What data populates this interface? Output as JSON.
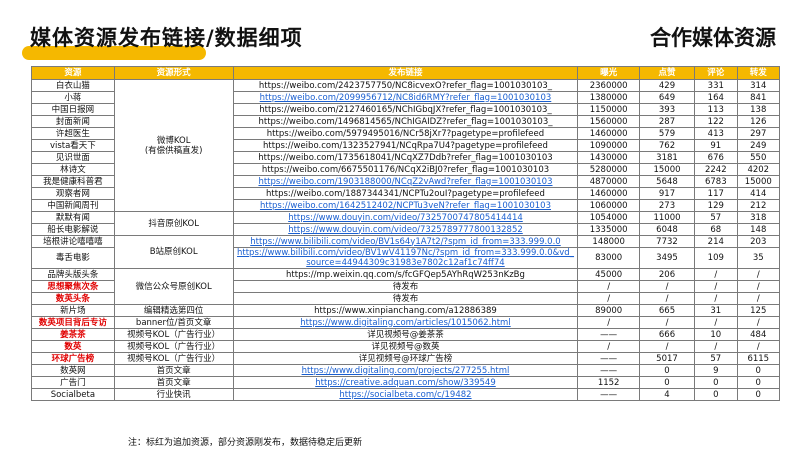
{
  "title_left": "媒体资源发布链接/数据细项",
  "title_right": "合作媒体资源",
  "accent_color": "#f5b800",
  "link_color": "#1a5fd0",
  "highlight_color": "#e00000",
  "headers": [
    "资源",
    "资源形式",
    "发布链接",
    "曝光",
    "点赞",
    "评论",
    "转发"
  ],
  "forms": {
    "weibo": "微博KOL\n(有偿供稿直发)",
    "douyin": "抖音原创KOL",
    "bilibili": "B站原创KOL",
    "wechat": "微信公众号原创KOL",
    "editor": "编辑精选第四位",
    "banner": "banner位/首页文章",
    "video1": "视频号KOL（广告行业）",
    "video2": "视频号KOL（广告行业）",
    "video3": "视频号KOL（广告行业）",
    "home1": "首页文章",
    "home2": "首页文章",
    "flash": "行业快讯"
  },
  "rows": [
    {
      "name": "白衣山猫",
      "link": "https://weibo.com/2423757750/NC8icvexO?refer_flag=1001030103_",
      "exposure": "2360000",
      "likes": "429",
      "comments": "331",
      "shares": "314"
    },
    {
      "name": "小蒋",
      "link": "https://weibo.com/2099956712/NC8id6RMY?refer_flag=1001030103",
      "exposure": "1380000",
      "likes": "649",
      "comments": "164",
      "shares": "841"
    },
    {
      "name": "中国日报网",
      "link": "https://weibo.com/2127460165/NChIGbqJX?refer_flag=1001030103_",
      "exposure": "1150000",
      "likes": "393",
      "comments": "113",
      "shares": "138"
    },
    {
      "name": "封面新闻",
      "link": "https://weibo.com/1496814565/NChIGAIDZ?refer_flag=1001030103_",
      "exposure": "1560000",
      "likes": "287",
      "comments": "122",
      "shares": "126"
    },
    {
      "name": "许超医生",
      "link": "https://weibo.com/5979495016/NCr58jXr7?pagetype=profilefeed",
      "exposure": "1460000",
      "likes": "579",
      "comments": "413",
      "shares": "297"
    },
    {
      "name": "vista看天下",
      "link": "https://weibo.com/1323527941/NCqRpa7U4?pagetype=profilefeed",
      "exposure": "1090000",
      "likes": "762",
      "comments": "91",
      "shares": "249"
    },
    {
      "name": "见识世面",
      "link": "https://weibo.com/1735618041/NCqXZ7Ddb?refer_flag=1001030103",
      "exposure": "1430000",
      "likes": "3181",
      "comments": "676",
      "shares": "550"
    },
    {
      "name": "林诗文",
      "link": "https://weibo.com/6675501176/NCqX2iBJ0?refer_flag=1001030103",
      "exposure": "5280000",
      "likes": "15000",
      "comments": "2242",
      "shares": "4202"
    },
    {
      "name": "我是健康科普君",
      "link": "https://weibo.com/1903188000/NCqZ2vAwd?refer_flag=1001030103",
      "exposure": "4870000",
      "likes": "5648",
      "comments": "6783",
      "shares": "15000"
    },
    {
      "name": "观察者网",
      "link": "https://weibo.com/1887344341/NCPTu2ouI?pagetype=profilefeed",
      "exposure": "1460000",
      "likes": "917",
      "comments": "117",
      "shares": "414"
    },
    {
      "name": "中国新闻周刊",
      "link": "https://weibo.com/1642512402/NCPTu3veN?refer_flag=1001030103",
      "exposure": "1060000",
      "likes": "273",
      "comments": "129",
      "shares": "212"
    },
    {
      "name": "默默有闻",
      "link": "https://www.douyin.com/video/7325700747805414414",
      "exposure": "1054000",
      "likes": "11000",
      "comments": "57",
      "shares": "318"
    },
    {
      "name": "船长电影解说",
      "link": "https://www.douyin.com/video/7325789777800132852",
      "exposure": "1335000",
      "likes": "6048",
      "comments": "68",
      "shares": "148"
    },
    {
      "name": "培根讲论嘻嘻嘻",
      "link": "https://www.bilibili.com/video/BV1s64y1A7t2/?spm_id_from=333.999.0.0",
      "exposure": "148000",
      "likes": "7732",
      "comments": "214",
      "shares": "203"
    },
    {
      "name": "毒舌电影",
      "link": "https://www.bilibili.com/video/BV1wV41197Nc/?spm_id_from=333.999.0.0&vd_source=44944309c31983e7802c12af1c74ff74",
      "exposure": "83000",
      "likes": "3495",
      "comments": "109",
      "shares": "35"
    },
    {
      "name": "品牌头版头条",
      "link": "https://mp.weixin.qq.com/s/fcGFQep5AYhRqW253nKzBg",
      "exposure": "45000",
      "likes": "206",
      "comments": "/",
      "shares": "/"
    },
    {
      "name": "思想聚焦次条",
      "link": "待发布",
      "exposure": "/",
      "likes": "/",
      "comments": "/",
      "shares": "/"
    },
    {
      "name": "数英头条",
      "link": "待发布",
      "exposure": "/",
      "likes": "/",
      "comments": "/",
      "shares": "/"
    },
    {
      "name": "新片场",
      "link": "https://www.xinpianchang.com/a12886389",
      "exposure": "89000",
      "likes": "665",
      "comments": "31",
      "shares": "125"
    },
    {
      "name": "数英项目背后专访",
      "link": "https://www.digitaling.com/articles/1015062.html",
      "exposure": "/",
      "likes": "/",
      "comments": "/",
      "shares": "/"
    },
    {
      "name": "姜茶茶",
      "link": "详见视频号@姜茶茶",
      "exposure": "——",
      "likes": "666",
      "comments": "10",
      "shares": "484"
    },
    {
      "name": "数英",
      "link": "详见视频号@数英",
      "exposure": "/",
      "likes": "/",
      "comments": "/",
      "shares": "/"
    },
    {
      "name": "环球广告榜",
      "link": "详见视频号@环球广告榜",
      "exposure": "——",
      "likes": "5017",
      "comments": "57",
      "shares": "6115"
    },
    {
      "name": "数英网",
      "link": "https://www.digitaling.com/projects/277255.html",
      "exposure": "——",
      "likes": "0",
      "comments": "9",
      "shares": "0"
    },
    {
      "name": "广告门",
      "link": "https://creative.adquan.com/show/339549",
      "exposure": "1152",
      "likes": "0",
      "comments": "0",
      "shares": "0"
    },
    {
      "name": "Socialbeta",
      "link": "https://socialbeta.com/c/19482",
      "exposure": "——",
      "likes": "4",
      "comments": "0",
      "shares": "0"
    }
  ],
  "note": "注：标红为追加资源，部分资源刚发布，数据待稳定后更新"
}
